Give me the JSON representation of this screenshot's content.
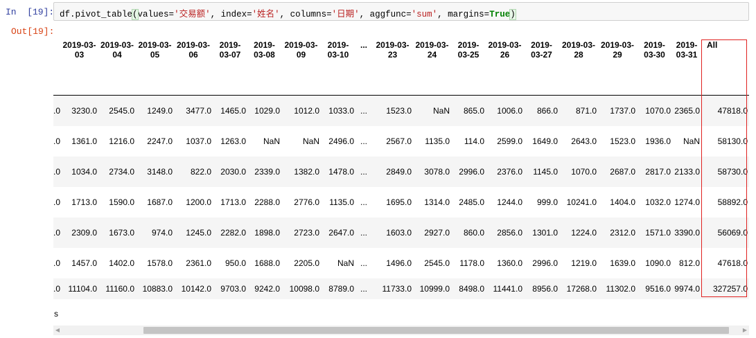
{
  "cell": {
    "in_prompt": "In  [19]:",
    "out_prompt": "Out[19]:",
    "code": {
      "p1": "df.pivot_table",
      "open": "(",
      "p2": "values=",
      "s1": "'交易额'",
      "p3": ", index=",
      "s2": "'姓名'",
      "p4": ", columns=",
      "s3": "'日期'",
      "p5": ", aggfunc=",
      "s4": "'sum'",
      "p6": ", margins=",
      "kw": "True",
      "close": ")"
    }
  },
  "table": {
    "columns": [
      "2019-03-03",
      "2019-03-04",
      "2019-03-05",
      "2019-03-06",
      "2019-03-07",
      "2019-03-08",
      "2019-03-09",
      "2019-03-10",
      "...",
      "2019-03-23",
      "2019-03-24",
      "2019-03-25",
      "2019-03-26",
      "2019-03-27",
      "2019-03-28",
      "2019-03-29",
      "2019-03-30",
      "2019-03-31",
      "All"
    ],
    "first_col_fragment": ".0",
    "rows": [
      [
        "3230.0",
        "2545.0",
        "1249.0",
        "3477.0",
        "1465.0",
        "1029.0",
        "1012.0",
        "1033.0",
        "...",
        "1523.0",
        "NaN",
        "865.0",
        "1006.0",
        "866.0",
        "871.0",
        "1737.0",
        "1070.0",
        "2365.0",
        "47818.0"
      ],
      [
        "1361.0",
        "1216.0",
        "2247.0",
        "1037.0",
        "1263.0",
        "NaN",
        "NaN",
        "2496.0",
        "...",
        "2567.0",
        "1135.0",
        "114.0",
        "2599.0",
        "1649.0",
        "2643.0",
        "1523.0",
        "1936.0",
        "NaN",
        "58130.0"
      ],
      [
        "1034.0",
        "2734.0",
        "3148.0",
        "822.0",
        "2030.0",
        "2339.0",
        "1382.0",
        "1478.0",
        "...",
        "2849.0",
        "3078.0",
        "2996.0",
        "2376.0",
        "1145.0",
        "1070.0",
        "2687.0",
        "2817.0",
        "2133.0",
        "58730.0"
      ],
      [
        "1713.0",
        "1590.0",
        "1687.0",
        "1200.0",
        "1713.0",
        "2288.0",
        "2776.0",
        "1135.0",
        "...",
        "1695.0",
        "1314.0",
        "2485.0",
        "1244.0",
        "999.0",
        "10241.0",
        "1404.0",
        "1032.0",
        "1274.0",
        "58892.0"
      ],
      [
        "2309.0",
        "1673.0",
        "974.0",
        "1245.0",
        "2282.0",
        "1898.0",
        "2723.0",
        "2647.0",
        "...",
        "1603.0",
        "2927.0",
        "860.0",
        "2856.0",
        "1301.0",
        "1224.0",
        "2312.0",
        "1571.0",
        "3390.0",
        "56069.0"
      ],
      [
        "1457.0",
        "1402.0",
        "1578.0",
        "2361.0",
        "950.0",
        "1688.0",
        "2205.0",
        "NaN",
        "...",
        "1496.0",
        "2545.0",
        "1178.0",
        "1360.0",
        "2996.0",
        "1219.0",
        "1639.0",
        "1090.0",
        "812.0",
        "47618.0"
      ],
      [
        "11104.0",
        "11160.0",
        "10883.0",
        "10142.0",
        "9703.0",
        "9242.0",
        "10098.0",
        "8789.0",
        "...",
        "11733.0",
        "10999.0",
        "8498.0",
        "11441.0",
        "8956.0",
        "17268.0",
        "11302.0",
        "9516.0",
        "9974.0",
        "327257.0"
      ]
    ],
    "stray_text": "s"
  },
  "colors": {
    "highlight_box": "#e0201f",
    "in_prompt": "#303f9f",
    "out_prompt": "#d84315"
  }
}
